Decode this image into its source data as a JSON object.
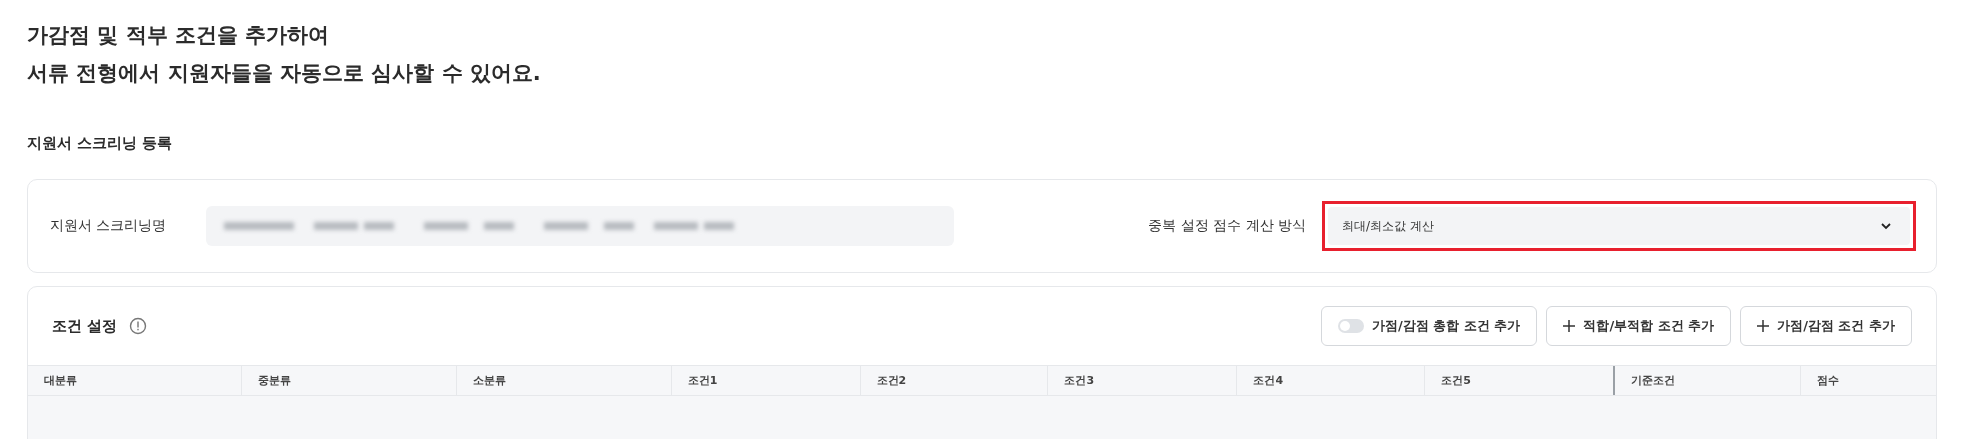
{
  "heading": {
    "lines": [
      "가감점 및 적부 조건을 추가하여",
      "서류 전형에서 지원자들을 자동으로 심사할 수 있어요."
    ]
  },
  "section_title": "지원서 스크리닝 등록",
  "screening_form": {
    "name_label": "지원서 스크리닝명",
    "name_value_blurred": true,
    "method_label": "중복 설정 점수 계산 방식",
    "method_value": "최대/최소값 계산",
    "method_highlighted": true
  },
  "conditions": {
    "title": "조건 설정",
    "buttons": [
      {
        "kind": "toggle",
        "label": "가점/감점 총합 조건 추가",
        "on": false
      },
      {
        "kind": "add",
        "label": "적합/부적합 조건 추가"
      },
      {
        "kind": "add",
        "label": "가점/감점 조건 추가"
      }
    ],
    "table": {
      "columns": [
        {
          "label": "대분류"
        },
        {
          "label": "중분류"
        },
        {
          "label": "소분류"
        },
        {
          "label": "조건1"
        },
        {
          "label": "조건2"
        },
        {
          "label": "조건3"
        },
        {
          "label": "조건4"
        },
        {
          "label": "조건5"
        },
        {
          "label": "기준조건"
        },
        {
          "label": "점수"
        }
      ]
    }
  }
}
